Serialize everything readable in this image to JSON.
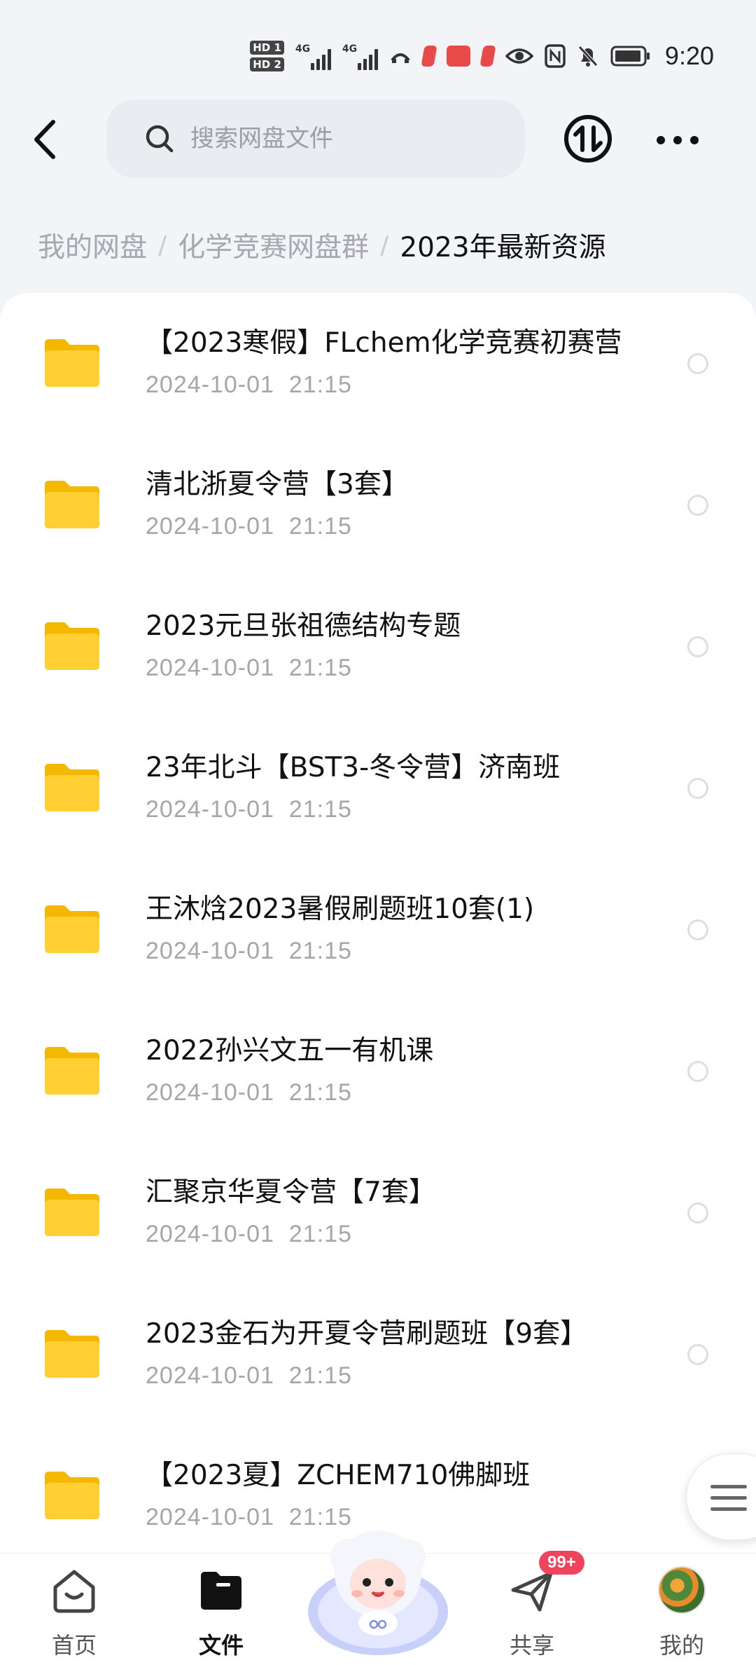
{
  "status_bar": {
    "hd1": "HD 1",
    "hd2": "HD 2",
    "net1": "4G",
    "net2": "4G",
    "time": "9:20"
  },
  "top_bar": {
    "search_placeholder": "搜索网盘文件"
  },
  "breadcrumb": {
    "items": [
      "我的网盘",
      "化学竞赛网盘群",
      "2023年最新资源"
    ],
    "separator": "/"
  },
  "files": [
    {
      "name": "【2023寒假】FLchem化学竞赛初赛营",
      "date": "2024-10-01  21:15"
    },
    {
      "name": "清北浙夏令营【3套】",
      "date": "2024-10-01  21:15"
    },
    {
      "name": "2023元旦张祖德结构专题",
      "date": "2024-10-01  21:15"
    },
    {
      "name": "23年北斗【BST3-冬令营】济南班",
      "date": "2024-10-01  21:15"
    },
    {
      "name": "王沐焓2023暑假刷题班10套(1)",
      "date": "2024-10-01  21:15"
    },
    {
      "name": "2022孙兴文五一有机课",
      "date": "2024-10-01  21:15"
    },
    {
      "name": "汇聚京华夏令营【7套】",
      "date": "2024-10-01  21:15"
    },
    {
      "name": "2023金石为开夏令营刷题班【9套】",
      "date": "2024-10-01  21:15"
    },
    {
      "name": "【2023夏】ZCHEM710佛脚班",
      "date": "2024-10-01  21:15"
    }
  ],
  "bottom_nav": {
    "home": "首页",
    "files": "文件",
    "share": "共享",
    "share_badge": "99+",
    "mine": "我的"
  },
  "colors": {
    "folder": "#ffc928",
    "badge": "#f0435c",
    "text_secondary": "#a3a6ab"
  }
}
